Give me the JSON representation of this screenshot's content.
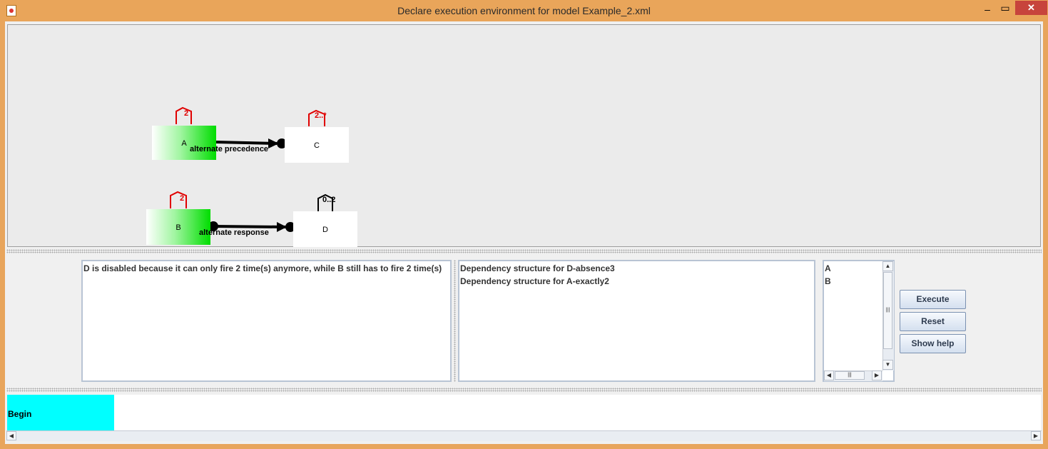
{
  "window": {
    "title": "Declare execution environment for model Example_2.xml",
    "minimize_glyph": "–",
    "maximize_glyph": "▭",
    "close_glyph": "✕",
    "app_icon": "java-cup-icon"
  },
  "model": {
    "activities": [
      {
        "id": "A",
        "label": "A",
        "state": "enabled",
        "constraint": "2",
        "constraint_color": "#e00000"
      },
      {
        "id": "C",
        "label": "C",
        "state": "idle",
        "constraint": "2..*",
        "constraint_color": "#e00000"
      },
      {
        "id": "B",
        "label": "B",
        "state": "enabled",
        "constraint": "2",
        "constraint_color": "#e00000"
      },
      {
        "id": "D",
        "label": "D",
        "state": "idle",
        "constraint": "0..2",
        "constraint_color": "#000000"
      }
    ],
    "relations": [
      {
        "from": "A",
        "to": "C",
        "label": "alternate precedence"
      },
      {
        "from": "B",
        "to": "D",
        "label": "alternate response"
      }
    ]
  },
  "panels": {
    "message_lines": [
      "D is disabled because it can only fire 2 time(s) anymore, while B still has to fire 2 time(s)"
    ],
    "dependency_lines": [
      "Dependency structure for D-absence3",
      "Dependency structure for A-exactly2"
    ],
    "event_list": [
      "A",
      "B"
    ]
  },
  "buttons": {
    "execute": "Execute",
    "reset": "Reset",
    "show_help": "Show help"
  },
  "trace": {
    "first_event": "Begin",
    "highlight_color": "#00ffff"
  },
  "scroll_glyphs": {
    "up": "▲",
    "down": "▼",
    "left": "◀",
    "right": "▶",
    "grip": "|||"
  }
}
